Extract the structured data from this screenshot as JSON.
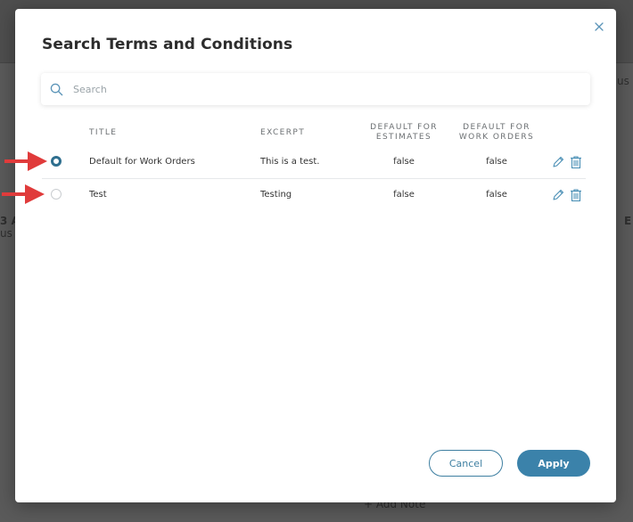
{
  "background": {
    "fragments": [
      "us",
      "3 A",
      "us",
      "E",
      "+ Add Note"
    ]
  },
  "modal": {
    "title": "Search Terms and Conditions",
    "close_icon": "close-icon"
  },
  "search": {
    "placeholder": "Search",
    "value": "",
    "icon": "search-icon"
  },
  "table": {
    "headers": {
      "title": "TITLE",
      "excerpt": "EXCERPT",
      "default_estimates": "DEFAULT FOR ESTIMATES",
      "default_work_orders": "DEFAULT FOR WORK ORDERS"
    },
    "rows": [
      {
        "selected": true,
        "title": "Default for Work Orders",
        "excerpt": "This is a test.",
        "default_estimates": "false",
        "default_work_orders": "false"
      },
      {
        "selected": false,
        "title": "Test",
        "excerpt": "Testing",
        "default_estimates": "false",
        "default_work_orders": "false"
      }
    ],
    "row_icons": [
      "pencil-icon",
      "trash-icon"
    ]
  },
  "annotations": {
    "arrow_color": "#e03b3b"
  },
  "footer": {
    "cancel_label": "Cancel",
    "apply_label": "Apply"
  },
  "colors": {
    "accent": "#3b82aa",
    "accent_dark": "#2f6f8f",
    "icon": "#4a8fb5"
  }
}
